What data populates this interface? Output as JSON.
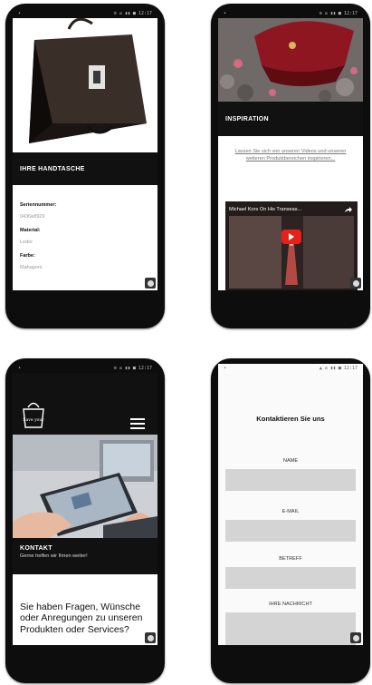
{
  "statusbar": {
    "left": "•",
    "right": "⚙ ✉ ▮▮ ■ 12:17",
    "right_dark": "▲ ✉ ▮▮ ■ 12:17"
  },
  "screen1": {
    "section_title": "IHRE HANDTASCHE",
    "fields": [
      {
        "label": "Seriennummer:",
        "value": "0436e8929"
      },
      {
        "label": "Material:",
        "value": "Leder"
      },
      {
        "label": "Farbe:",
        "value": "Mahagoni"
      }
    ]
  },
  "screen2": {
    "section_title": "INSPIRATION",
    "link_text": "Lassen Sie sich von unseren Videos und unseren weiteren Produktbereichen inspirieren...",
    "video_title": "Michael Kors On His Transeas..."
  },
  "screen3": {
    "logo_text": "Save your",
    "section_title": "KONTAKT",
    "section_subtitle": "Gerne helfen wir Ihnen weiter!",
    "question": "Sie haben Fragen, Wünsche oder Anregungen zu unseren Produkten oder Services?"
  },
  "screen4": {
    "title": "Kontaktieren Sie uns",
    "fields": [
      {
        "label": "NAME"
      },
      {
        "label": "E-MAIL"
      },
      {
        "label": "BETREFF"
      },
      {
        "label": "IHRE NACHRICHT"
      }
    ]
  },
  "colors": {
    "dark": "#111111",
    "field": "#d4d4d4",
    "youtube_red": "#e62117"
  }
}
